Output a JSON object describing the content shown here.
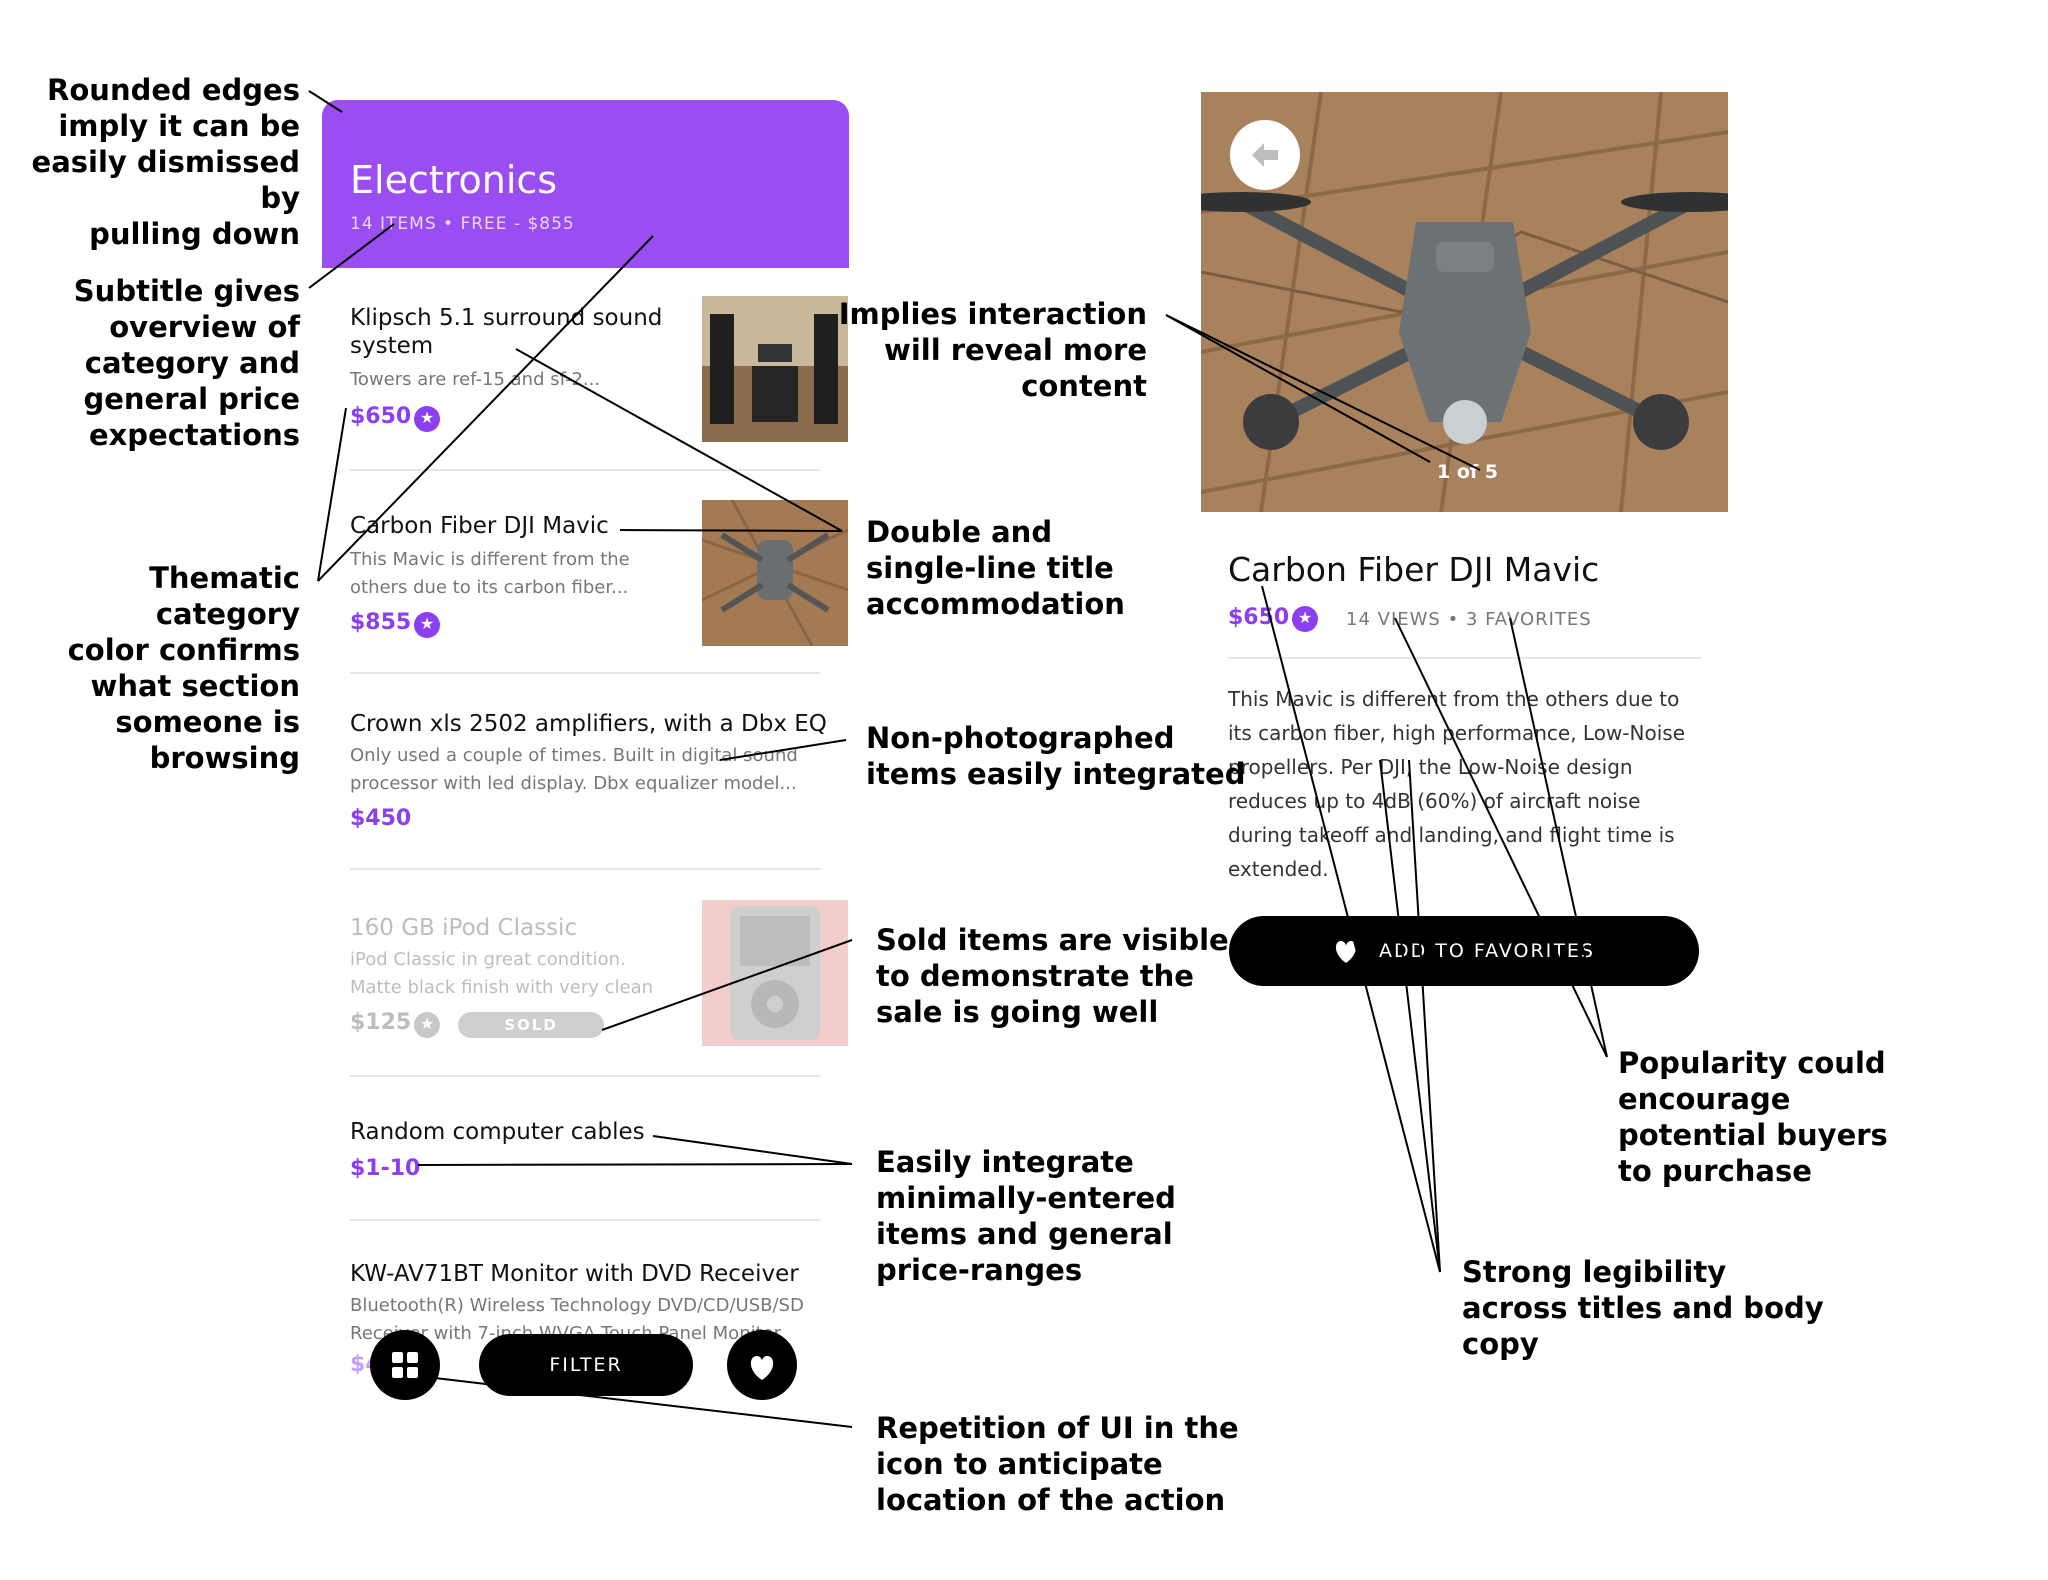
{
  "colors": {
    "accent": "#9a4df0",
    "price": "#8b3ff0",
    "button": "#000000"
  },
  "list_screen": {
    "header": {
      "title": "Electronics",
      "subtitle": "14 ITEMS • FREE - $855"
    },
    "items": [
      {
        "title": "Klipsch 5.1 surround sound system",
        "desc": "Towers are ref-15 and sf-2...",
        "price": "$650",
        "featured": true,
        "has_thumb": true
      },
      {
        "title": "Carbon Fiber DJI Mavic",
        "desc": "This Mavic is different from the others due to its carbon fiber...",
        "price": "$855",
        "featured": true,
        "has_thumb": true
      },
      {
        "title": "Crown xls 2502 amplifiers, with a Dbx EQ",
        "desc": "Only used a couple of times. Built in digital sound processor with led display. Dbx equalizer model...",
        "price": "$450",
        "featured": false,
        "has_thumb": false
      },
      {
        "title": "160 GB iPod Classic",
        "desc": "iPod Classic in great condition. Matte black finish with very clean",
        "price": "$125",
        "featured": true,
        "has_thumb": true,
        "sold_label": "SOLD"
      },
      {
        "title": "Random computer cables",
        "desc": "",
        "price": "$1-10",
        "featured": false,
        "has_thumb": false
      },
      {
        "title": "KW-AV71BT Monitor with DVD Receiver",
        "desc": "Bluetooth(R) Wireless Technology DVD/CD/USB/SD Receiver with 7-inch WVGA Touch Panel Monitor",
        "price": "$4",
        "featured": false,
        "has_thumb": false
      }
    ],
    "bottom_bar": {
      "filter_label": "FILTER",
      "grid_icon": "grid-icon",
      "heart_icon": "heart-icon"
    }
  },
  "detail_screen": {
    "photo_counter": "1 of 5",
    "back_icon": "back-arrow-icon",
    "title": "Carbon Fiber DJI Mavic",
    "price": "$650",
    "stats": "14 VIEWS • 3 FAVORITES",
    "description": "This Mavic is different from the others due to its carbon fiber, high performance, Low-Noise propellers. Per DJI, the Low-Noise design reduces up to 4dB (60%) of aircraft noise during takeoff and landing, and flight time is extended.",
    "add_favorites_label": "ADD TO FAVORITES"
  },
  "annotations": {
    "rounded_edges": "Rounded edges\nimply it can be\neasily dismissed by\npulling down",
    "subtitle": "Subtitle gives\noverview of\ncategory and\ngeneral price\nexpectations",
    "thematic": "Thematic category\ncolor confirms\nwhat section\nsomeone is\nbrowsing",
    "implies": "Implies interaction\nwill reveal more\ncontent",
    "double": "Double and\nsingle-line title\naccommodation",
    "nonphoto": "Non-photographed\nitems easily integrated",
    "sold": "Sold items are visible\nto demonstrate the\nsale is going well",
    "minimal": "Easily integrate\nminimally-entered\nitems and general\nprice-ranges",
    "repetition": "Repetition of UI in the\nicon to anticipate\nlocation of the action",
    "popularity": "Popularity could\nencourage\npotential buyers\nto purchase",
    "legibility": "Strong legibility\nacross titles and body\ncopy"
  }
}
